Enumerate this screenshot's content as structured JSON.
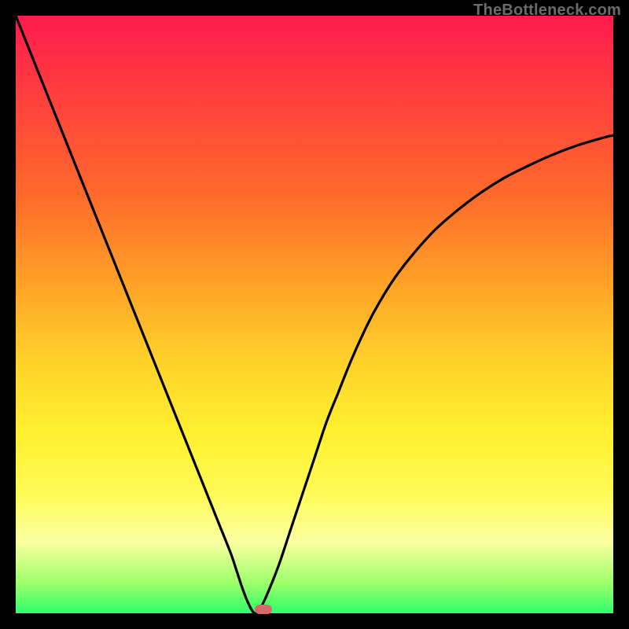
{
  "watermark": "TheBottleneck.com",
  "colors": {
    "gradient_top": "#ff1a4d",
    "gradient_bottom": "#2dff6a",
    "curve": "#000000",
    "marker": "#d66a6a",
    "frame": "#000000"
  },
  "chart_data": {
    "type": "line",
    "title": "",
    "xlabel": "",
    "ylabel": "",
    "xlim": [
      0,
      100
    ],
    "ylim": [
      0,
      100
    ],
    "min_point_x": 40,
    "series": [
      {
        "name": "curve",
        "x": [
          0,
          2,
          4,
          6,
          8,
          10,
          12,
          14,
          16,
          18,
          20,
          22,
          24,
          26,
          28,
          30,
          32,
          34,
          36,
          37,
          38,
          39,
          40,
          41,
          42,
          44,
          46,
          48,
          50,
          52,
          54,
          56,
          58,
          60,
          63,
          66,
          70,
          74,
          78,
          82,
          86,
          90,
          94,
          98,
          100
        ],
        "y": [
          100,
          95,
          90,
          85,
          80,
          75,
          70,
          65,
          60,
          55,
          50,
          45,
          40,
          35,
          30,
          25,
          20,
          15,
          10,
          7,
          4,
          1.5,
          0,
          1,
          3,
          8,
          14,
          20,
          26,
          32,
          37,
          42,
          46.5,
          50.5,
          55.5,
          59.5,
          64,
          67.5,
          70.5,
          73,
          75,
          76.8,
          78.3,
          79.5,
          80
        ]
      }
    ],
    "marker": {
      "x": 41.5,
      "y": 0
    }
  }
}
